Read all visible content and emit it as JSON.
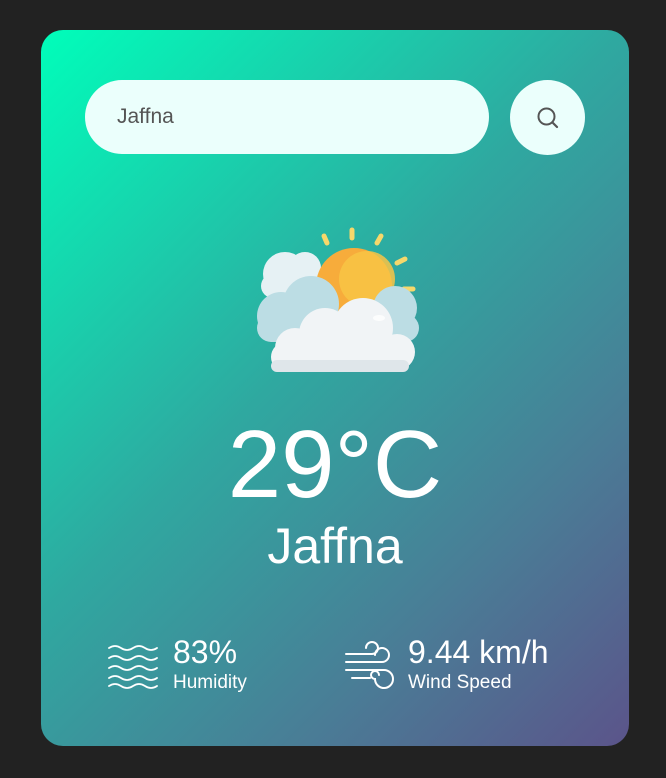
{
  "search": {
    "value": "Jaffna",
    "icon": "search-icon"
  },
  "weather": {
    "icon": "partly-cloudy-sun-icon",
    "temperature": "29°C",
    "city": "Jaffna"
  },
  "details": {
    "humidity": {
      "icon": "humidity-waves-icon",
      "value": "83%",
      "label": "Humidity"
    },
    "wind": {
      "icon": "wind-icon",
      "value": "9.44 km/h",
      "label": "Wind Speed"
    }
  },
  "colors": {
    "background": "#222222",
    "gradient_start": "#00feba",
    "gradient_end": "#5b548a",
    "input_bg": "#ebfffc",
    "text": "#ffffff"
  }
}
